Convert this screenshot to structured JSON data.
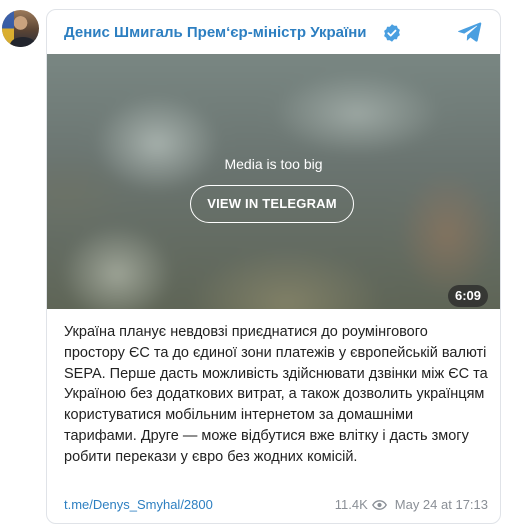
{
  "channel": {
    "name": "Денис Шмигаль Прем‘єр-міністр України",
    "verified_icon": "verified-badge-icon",
    "app_icon": "telegram-logo-icon"
  },
  "media": {
    "message": "Media is too big",
    "button_label": "VIEW IN TELEGRAM",
    "duration": "6:09"
  },
  "post": {
    "text": "Україна планує невдовзі приєднатися до роумінгового простору ЄС та до єдиної зони платежів у європейській валюті SEPA. Перше дасть можливість здійснювати дзвінки між ЄС та Україною без додаткових витрат, а також дозволить українцям користуватися мобільним інтернетом за домашніми тарифами. Друге — може відбутися вже влітку і дасть змогу робити перекази у євро без жодних комісій.",
    "link": "t.me/Denys_Smyhal/2800",
    "views": "11.4K",
    "date": "May 24 at 17:13"
  },
  "colors": {
    "accent": "#2d7fc1",
    "verified": "#4a9fe0",
    "muted": "#8a8f96"
  }
}
